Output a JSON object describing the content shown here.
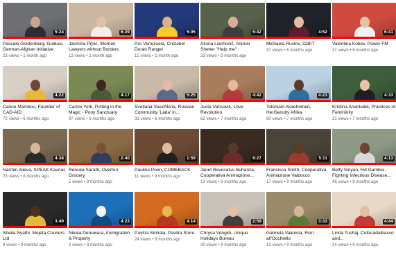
{
  "videos": [
    {
      "title": "Pascale Goldenberg, Guldusi, German-Afghan Initiative",
      "views": "23 views",
      "age": "1 month ago",
      "duration": "5:24",
      "progress": 1.0,
      "colors": {
        "bg": "#6d6f73",
        "fg": "#c9a58d",
        "cloth": "#2c2d31"
      }
    },
    {
      "title": "Jasmina Prpic, Women Lawyers without Borders",
      "views": "13 views",
      "age": "1 month ago",
      "duration": "6:29",
      "progress": 1.0,
      "colors": {
        "bg": "#c9b7a2",
        "fg": "#e0c0a8",
        "cloth": "#f2efe9"
      }
    },
    {
      "title": "Pro Venezuela, Cristabel Durán Rangel",
      "views": "15 views",
      "age": "1 month ago",
      "duration": "5:05",
      "progress": 1.0,
      "colors": {
        "bg": "#233a7a",
        "fg": "#d9b28e",
        "cloth": "#f3cc2a"
      }
    },
    {
      "title": "Aliona Liachovič, Animal Shelter \"Help me\"",
      "views": "33 views",
      "age": "5 months ago",
      "duration": "6:42",
      "progress": 1.0,
      "colors": {
        "bg": "#58614a",
        "fg": "#d8b09a",
        "cloth": "#3d3d3d"
      }
    },
    {
      "title": "Michaela Rustov, 32BIT",
      "views": "37 views",
      "age": "6 months ago",
      "duration": "4:52",
      "progress": 1.0,
      "colors": {
        "bg": "#20232a",
        "fg": "#e4bda5",
        "cloth": "#5a1f2a"
      }
    },
    {
      "title": "Valentina Kobev, Power FM",
      "views": "37 views",
      "age": "6 months ago",
      "duration": "6:41",
      "progress": 1.0,
      "colors": {
        "bg": "#cf4b3e",
        "fg": "#e5c2a7",
        "cloth": "#f0f0f0"
      }
    },
    {
      "title": "Carine Mambou, Founder of CAD-AID",
      "views": "72 views",
      "age": "6 months ago",
      "duration": "4:22",
      "progress": 1.0,
      "colors": {
        "bg": "#d8cfc4",
        "fg": "#6f4631",
        "cloth": "#e7b83a"
      }
    },
    {
      "title": "Carole York, Putting in the Magic - Pony Sanctuary",
      "views": "97 views",
      "age": "6 months ago",
      "duration": "4:17",
      "progress": 1.0,
      "colors": {
        "bg": "#7b8a55",
        "fg": "#3a2a22",
        "cloth": "#4a5a34"
      }
    },
    {
      "title": "Svetlana Vasichkina, Russian Community 'Lada' in...",
      "views": "33 views",
      "age": "6 months ago",
      "duration": "5:25",
      "progress": 1.0,
      "colors": {
        "bg": "#c8b9a8",
        "fg": "#e0bca4",
        "cloth": "#5a6b87"
      }
    },
    {
      "title": "Justa Vansović, Love Revolution",
      "views": "63 views",
      "age": "7 months ago",
      "duration": "4:42",
      "progress": 1.0,
      "colors": {
        "bg": "#a97c5b",
        "fg": "#e2b99c",
        "cloth": "#b33c3c"
      }
    },
    {
      "title": "Toloniani Akaehomen, HerGenuity Afrika",
      "views": "60 views",
      "age": "7 months ago",
      "duration": "4:23",
      "progress": 1.0,
      "colors": {
        "bg": "#b9d1e2",
        "fg": "#5b3a28",
        "cloth": "#2c6f9d"
      }
    },
    {
      "title": "Kristina Anankaité, Practices of Femininity",
      "views": "21 views",
      "age": "7 months ago",
      "duration": "4:33",
      "progress": 1.0,
      "colors": {
        "bg": "#3d5e3a",
        "fg": "#e6c3a8",
        "cloth": "#1f1f1f"
      }
    },
    {
      "title": "Narmin Alieva, SPEAK Kaunas",
      "views": "23 views",
      "age": "8 months ago",
      "duration": "4:38",
      "progress": 1.0,
      "colors": {
        "bg": "#7a6852",
        "fg": "#d9b59b",
        "cloth": "#2a2a2a"
      }
    },
    {
      "title": "Renuka Sarath, Overton Grocery",
      "views": "5 views",
      "age": "9 months ago",
      "duration": "2:40",
      "progress": 1.0,
      "colors": {
        "bg": "#8a6b45",
        "fg": "#7a513a",
        "cloth": "#2e3e5c"
      }
    },
    {
      "title": "Pauline Poon, COMEBACK",
      "views": "11 views",
      "age": "9 months ago",
      "duration": "1:59",
      "progress": 1.0,
      "colors": {
        "bg": "#6a4a34",
        "fg": "#e0bca0",
        "cloth": "#202020"
      }
    },
    {
      "title": "Janet Revocatus Buhanza, Cooperativa Animazione...",
      "views": "13 views",
      "age": "9 months ago",
      "duration": "6:27",
      "progress": 1.0,
      "colors": {
        "bg": "#3b2a20",
        "fg": "#5a3a26",
        "cloth": "#6a2b2b"
      }
    },
    {
      "title": "Francisca Smith, Cooperativa Animazione Valdocco",
      "views": "17 views",
      "age": "9 months ago",
      "duration": "5:11",
      "progress": 1.0,
      "colors": {
        "bg": "#4a4338",
        "fg": "#5b3a27",
        "cloth": "#9c3a2f"
      }
    },
    {
      "title": "Betty Sinyan, Fid Gambia - Fighting Infectious Disease...",
      "views": "46 views",
      "age": "9 months ago",
      "duration": "4:13",
      "progress": 1.0,
      "colors": {
        "bg": "#8f9a86",
        "fg": "#6b4530",
        "cloth": "#d8d8d8"
      }
    },
    {
      "title": "Sheila Nyathi, Mejeta Couriers Ltd",
      "views": "9 views",
      "age": "9 months ago",
      "duration": "3:49",
      "progress": 1.0,
      "colors": {
        "bg": "#2b2b2b",
        "fg": "#4d2f1f",
        "cloth": "#e2b93a"
      }
    },
    {
      "title": "Niluka Denuwara, Immigration & Property",
      "views": "2 views",
      "age": "9 months ago",
      "duration": "4:23",
      "progress": 1.0,
      "colors": {
        "bg": "#1d6fb8",
        "fg": "#f2f2f2",
        "cloth": "#0e4c86"
      }
    },
    {
      "title": "Pavitra Sinhala, Pavitra Store",
      "views": "24 views",
      "age": "9 months ago",
      "duration": "4:14",
      "progress": 1.0,
      "colors": {
        "bg": "#d26a1f",
        "fg": "#e8b84a",
        "cloth": "#b23a20"
      }
    },
    {
      "title": "Chrysa Vongkli, Unique Holidays Bureau",
      "views": "30 views",
      "age": "9 months ago",
      "duration": "2:59",
      "progress": 1.0,
      "colors": {
        "bg": "#c9c2b8",
        "fg": "#e3c0a5",
        "cloth": "#3f3f3f"
      }
    },
    {
      "title": "Gabriela Valencia, Fiori all'Occhiello",
      "views": "13 views",
      "age": "9 months ago",
      "duration": "3:33",
      "progress": 1.0,
      "colors": {
        "bg": "#9a8a6a",
        "fg": "#d8b498",
        "cloth": "#5b7a3a"
      }
    },
    {
      "title": "Linda Tushaj, Culturadalbasso and...",
      "views": "14 views",
      "age": "9 months ago",
      "duration": "4:44",
      "progress": 1.0,
      "colors": {
        "bg": "#e8d9c7",
        "fg": "#e0bfa3",
        "cloth": "#c23b3b"
      }
    }
  ]
}
